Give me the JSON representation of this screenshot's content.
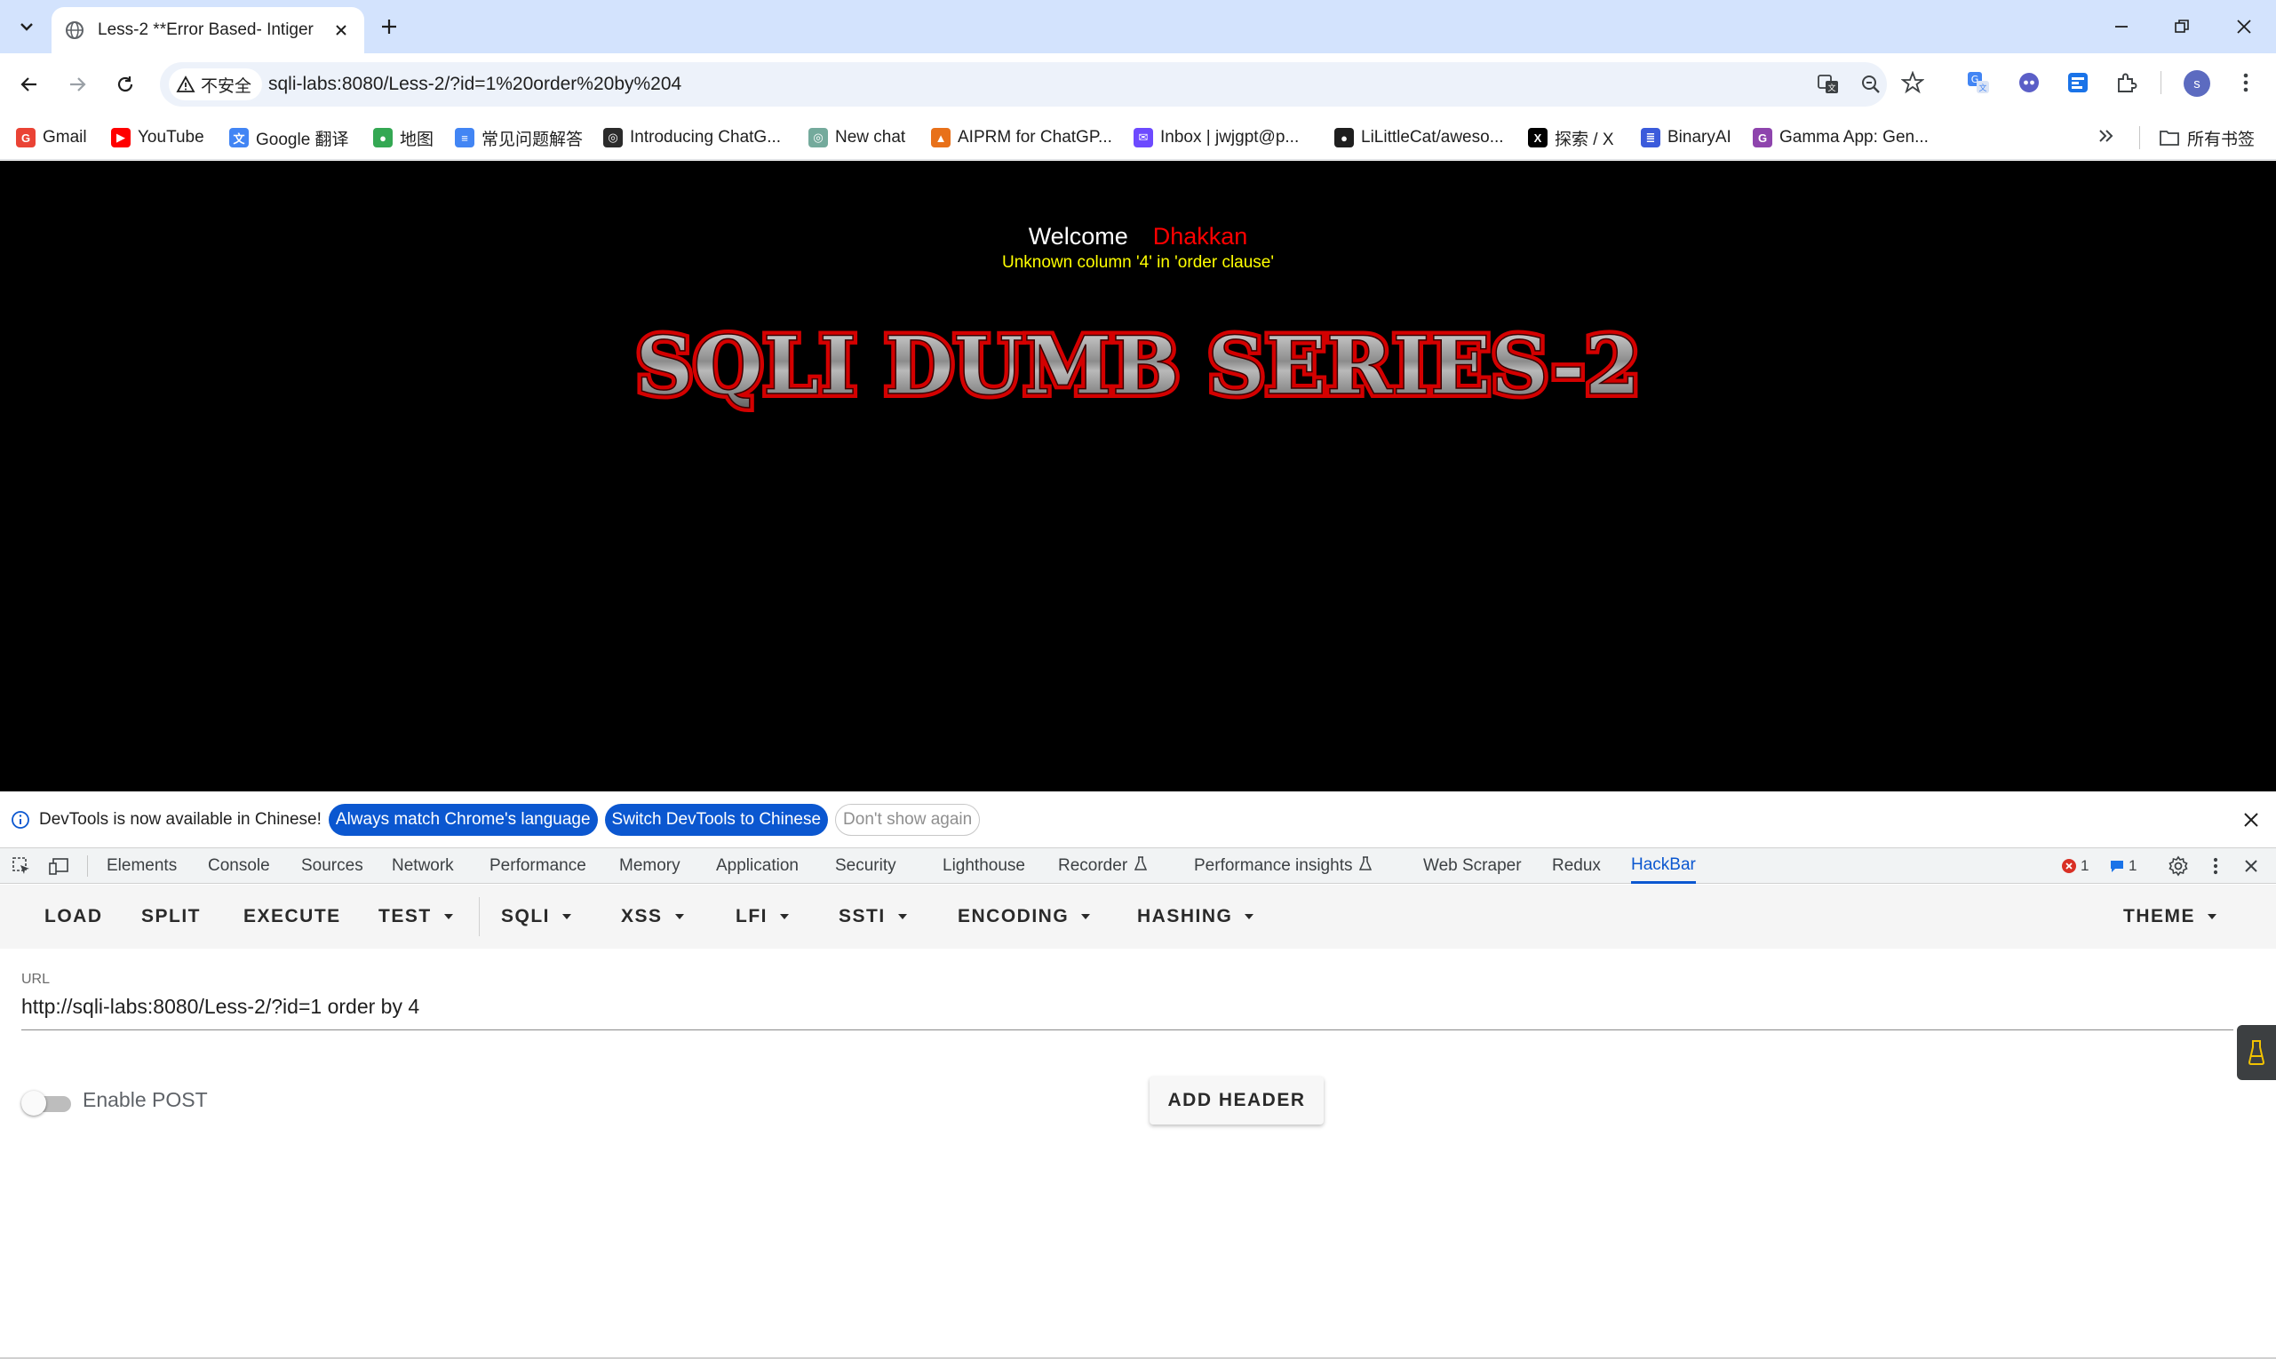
{
  "browser": {
    "tab_title": "Less-2 **Error Based- Intiger",
    "security_label": "不安全",
    "address": "sqli-labs:8080/Less-2/?id=1%20order%20by%204",
    "profile_initial": "s"
  },
  "bookmarks": [
    {
      "label": "Gmail",
      "icon": "gmail-icon",
      "color": "#ea4335",
      "glyph": "G"
    },
    {
      "label": "YouTube",
      "icon": "youtube-icon",
      "color": "#ff0000",
      "glyph": "▶"
    },
    {
      "label": "Google 翻译",
      "icon": "google-translate-icon",
      "color": "#4285f4",
      "glyph": "文"
    },
    {
      "label": "地图",
      "icon": "maps-icon",
      "color": "#34a853",
      "glyph": "●"
    },
    {
      "label": "常见问题解答",
      "icon": "docs-icon",
      "color": "#4285f4",
      "glyph": "≡"
    },
    {
      "label": "Introducing ChatG...",
      "icon": "openai-icon",
      "color": "#2b2b2b",
      "glyph": "◎"
    },
    {
      "label": "New chat",
      "icon": "chatgpt-icon",
      "color": "#74aa9c",
      "glyph": "◎"
    },
    {
      "label": "AIPRM for ChatGP...",
      "icon": "aiprm-icon",
      "color": "#e8711a",
      "glyph": "▲"
    },
    {
      "label": "Inbox | jwjgpt@p...",
      "icon": "proton-mail-icon",
      "color": "#6d4aff",
      "glyph": "✉"
    },
    {
      "label": "LiLittleCat/aweso...",
      "icon": "github-icon",
      "color": "#1f1f1f",
      "glyph": "●"
    },
    {
      "label": "探索 / X",
      "icon": "x-icon",
      "color": "#000000",
      "glyph": "X"
    },
    {
      "label": "BinaryAI",
      "icon": "binaryai-icon",
      "color": "#3b5bdb",
      "glyph": "≣"
    },
    {
      "label": "Gamma App: Gen...",
      "icon": "gamma-icon",
      "color": "#8e44ad",
      "glyph": "G"
    }
  ],
  "all_bookmarks_label": "所有书签",
  "page": {
    "welcome": "Welcome",
    "user": "Dhakkan",
    "error": "Unknown column '4' in 'order clause'",
    "logo_text": "SQLI DUMB SERIES-2"
  },
  "infobar": {
    "message": "DevTools is now available in Chinese!",
    "btn_match": "Always match Chrome's language",
    "btn_switch": "Switch DevTools to Chinese",
    "btn_dont_show": "Don't show again"
  },
  "devtools": {
    "tabs": [
      "Elements",
      "Console",
      "Sources",
      "Network",
      "Performance",
      "Memory",
      "Application",
      "Security",
      "Lighthouse",
      "Recorder",
      "Performance insights",
      "Web Scraper",
      "Redux",
      "HackBar"
    ],
    "error_count": "1",
    "message_count": "1"
  },
  "hackbar": {
    "buttons": [
      "LOAD",
      "SPLIT",
      "EXECUTE",
      "TEST",
      "SQLI",
      "XSS",
      "LFI",
      "SSTI",
      "ENCODING",
      "HASHING",
      "THEME"
    ],
    "url_label": "URL",
    "url_value": "http://sqli-labs:8080/Less-2/?id=1 order by 4",
    "enable_post_label": "Enable POST",
    "enable_post_on": false,
    "add_header_label": "ADD HEADER"
  },
  "colors": {
    "accent": "#0b57d0",
    "tabstrip": "#d3e3fd",
    "page_bg": "#000000",
    "welcome_user": "#ff0000",
    "error_text": "#ffff00"
  }
}
